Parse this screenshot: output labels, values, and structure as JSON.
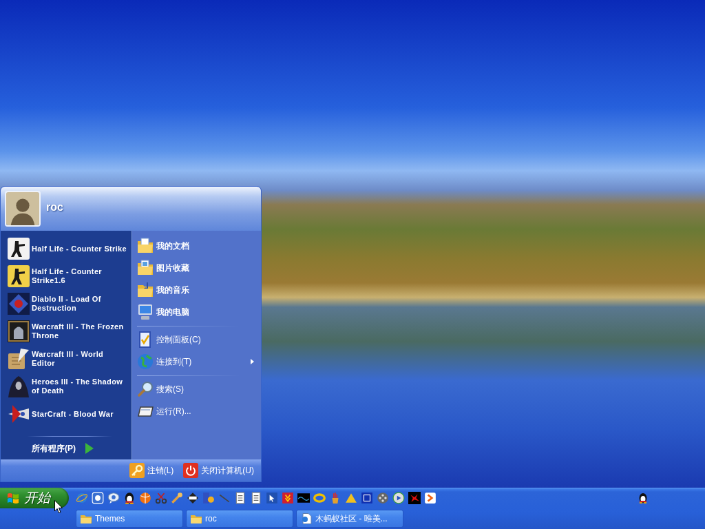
{
  "start_menu": {
    "user": {
      "name": "roc"
    },
    "pinned_programs": [
      {
        "label": "Half Life - Counter Strike"
      },
      {
        "label": "Half Life - Counter Strike1.6"
      },
      {
        "label": "Diablo II - Load Of Destruction"
      },
      {
        "label": "Warcraft III - The Frozen Throne"
      },
      {
        "label": "Warcraft III - World Editor"
      },
      {
        "label": "Heroes III - The Shadow of Death"
      },
      {
        "label": "StarCraft - Blood War"
      }
    ],
    "all_programs": {
      "label": "所有程序(P)"
    },
    "places": [
      [
        {
          "label": "我的文档",
          "kind": "folder",
          "submenu": false
        },
        {
          "label": "图片收藏",
          "kind": "folder",
          "submenu": false
        },
        {
          "label": "我的音乐",
          "kind": "folder",
          "submenu": false
        },
        {
          "label": "我的电脑",
          "kind": "folder",
          "submenu": false
        }
      ],
      [
        {
          "label": "控制面板(C)",
          "kind": "command",
          "submenu": false
        },
        {
          "label": "连接到(T)",
          "kind": "command",
          "submenu": true
        }
      ],
      [
        {
          "label": "搜索(S)",
          "kind": "command",
          "submenu": false
        },
        {
          "label": "运行(R)...",
          "kind": "command",
          "submenu": false
        }
      ]
    ],
    "footer_buttons": [
      {
        "label": "注销(L)",
        "kind": "logoff"
      },
      {
        "label": "关闭计算机(U)",
        "kind": "shutdown"
      }
    ]
  },
  "taskbar": {
    "start_button": {
      "label": "开始"
    },
    "task_buttons": [
      {
        "label": "Themes",
        "kind": "folder"
      },
      {
        "label": "roc",
        "kind": "folder"
      },
      {
        "label": "木蚂蚁社区 - 唯美...",
        "kind": "browser"
      }
    ]
  }
}
